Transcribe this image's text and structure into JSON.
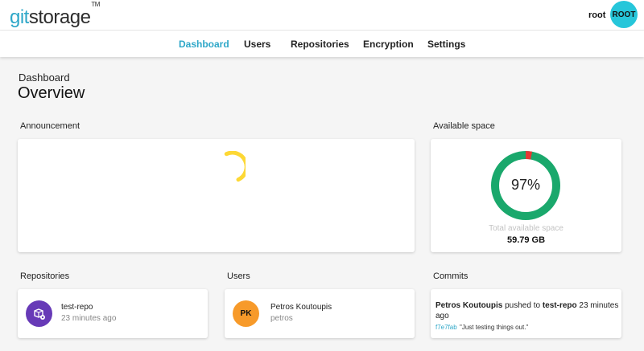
{
  "header": {
    "logo_part1": "git",
    "logo_part2": "storage",
    "logo_tm": "TM",
    "username": "root",
    "avatar_label": "ROOT",
    "accent_color": "#2ea7c8"
  },
  "nav": {
    "items": [
      {
        "label": "Dashboard",
        "active": true
      },
      {
        "label": "Users",
        "active": false
      },
      {
        "label": "Repositories",
        "active": false
      },
      {
        "label": "Encryption",
        "active": false
      },
      {
        "label": "Settings",
        "active": false
      }
    ]
  },
  "page": {
    "breadcrumb": "Dashboard",
    "title": "Overview"
  },
  "announcement": {
    "label": "Announcement",
    "loading": true,
    "spinner_color": "#fdd835"
  },
  "space": {
    "label": "Available space",
    "percent": 97,
    "percent_text": "97%",
    "caption": "Total available space",
    "value": "59.79 GB",
    "free_color": "#1aa86c",
    "used_color": "#e53935"
  },
  "repositories": {
    "label": "Repositories",
    "items": [
      {
        "name": "test-repo",
        "time": "23 minutes ago",
        "icon": "repository-icon",
        "color": "#673ab7"
      }
    ]
  },
  "users": {
    "label": "Users",
    "items": [
      {
        "initials": "PK",
        "name": "Petros Koutoupis",
        "username": "petros",
        "color": "#f79a2a"
      }
    ]
  },
  "commits": {
    "label": "Commits",
    "items": [
      {
        "author": "Petros Koutoupis",
        "action": " pushed to ",
        "repo": "test-repo",
        "time": " 23 minutes ago",
        "hash": "f7e7fab",
        "message": "\"Just testing things out.\""
      }
    ]
  }
}
